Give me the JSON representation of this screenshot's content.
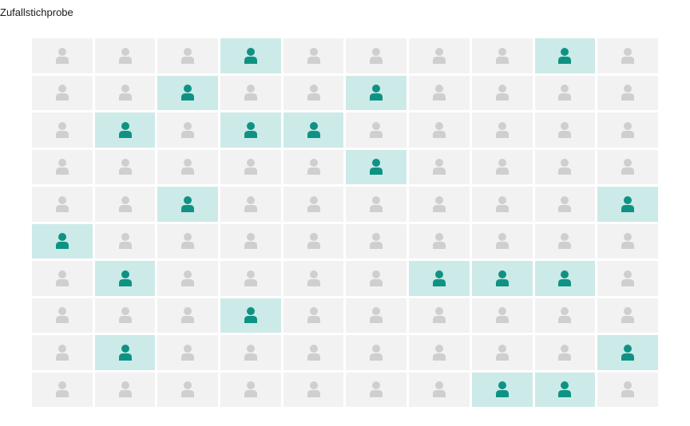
{
  "title": "Zufallstichprobe",
  "grid": {
    "rows": 10,
    "cols": 10,
    "selected": [
      [
        0,
        3
      ],
      [
        0,
        8
      ],
      [
        1,
        2
      ],
      [
        1,
        5
      ],
      [
        2,
        1
      ],
      [
        2,
        3
      ],
      [
        2,
        4
      ],
      [
        3,
        5
      ],
      [
        4,
        2
      ],
      [
        4,
        9
      ],
      [
        5,
        0
      ],
      [
        6,
        1
      ],
      [
        6,
        6
      ],
      [
        6,
        7
      ],
      [
        6,
        8
      ],
      [
        7,
        3
      ],
      [
        8,
        1
      ],
      [
        8,
        9
      ],
      [
        9,
        7
      ],
      [
        9,
        8
      ]
    ]
  },
  "colors": {
    "cell_bg": "#f2f2f2",
    "selected_bg": "#cceae8",
    "icon_default": "#cfcfcf",
    "icon_selected": "#0f9284"
  },
  "icon": "person-icon"
}
